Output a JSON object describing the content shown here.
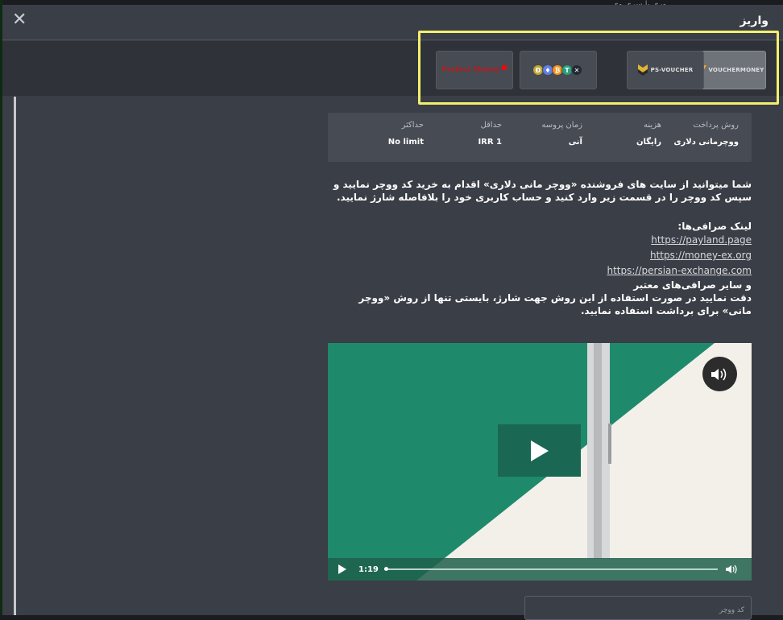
{
  "background": {
    "top_text": "وری با سری وی"
  },
  "modal": {
    "title": "واریز",
    "close_label": "✕"
  },
  "methods": [
    {
      "id": "voucher-money",
      "label": "VOUCHERMONEY",
      "active": true
    },
    {
      "id": "ps-voucher",
      "label": "PS-VOUCHER",
      "active": false
    },
    {
      "id": "crypto",
      "label": "",
      "active": false,
      "coins": [
        "Đ",
        "♦",
        "₿",
        "T",
        "✕"
      ]
    },
    {
      "id": "perfect-money",
      "label": "Perfect Money",
      "active": false
    }
  ],
  "info": {
    "method": {
      "header": "روش پرداخت",
      "value": "ووچرمانی دلاری"
    },
    "fee": {
      "header": "هزینه",
      "value": "رایگان"
    },
    "process_time": {
      "header": "زمان پروسه",
      "value": "آنی"
    },
    "min": {
      "header": "حداقل",
      "value": "IRR 1"
    },
    "max": {
      "header": "حداکثر",
      "value": "No limit"
    }
  },
  "description": {
    "para1": "شما میتوانید از سایت های فروشنده «ووچر مانی دلاری» اقدام به خرید کد ووچر نمایید و سپس کد ووچر را در قسمت زیر وارد کنید و حساب کاربری خود را بلافاصله شارژ نمایید.",
    "links_title": "لینک صرافی‌ها:",
    "links": [
      "https://payland.page",
      "https://money-ex.org",
      "https://persian-exchange.com"
    ],
    "other": "و سایر صرافی‌های معتبر",
    "note": "دقت نمایید در صورت استفاده از این روش جهت شارژ، بایستی تنها از روش «ووچر مانی» برای برداشت استفاده نمایید."
  },
  "video": {
    "time": "1:19",
    "progress": 0.0
  },
  "input": {
    "placeholder": "کد ووچر"
  },
  "colors": {
    "highlight": "#f3ef6e",
    "video_green": "#1e8a6b",
    "modal_bg": "#3a3e46"
  }
}
